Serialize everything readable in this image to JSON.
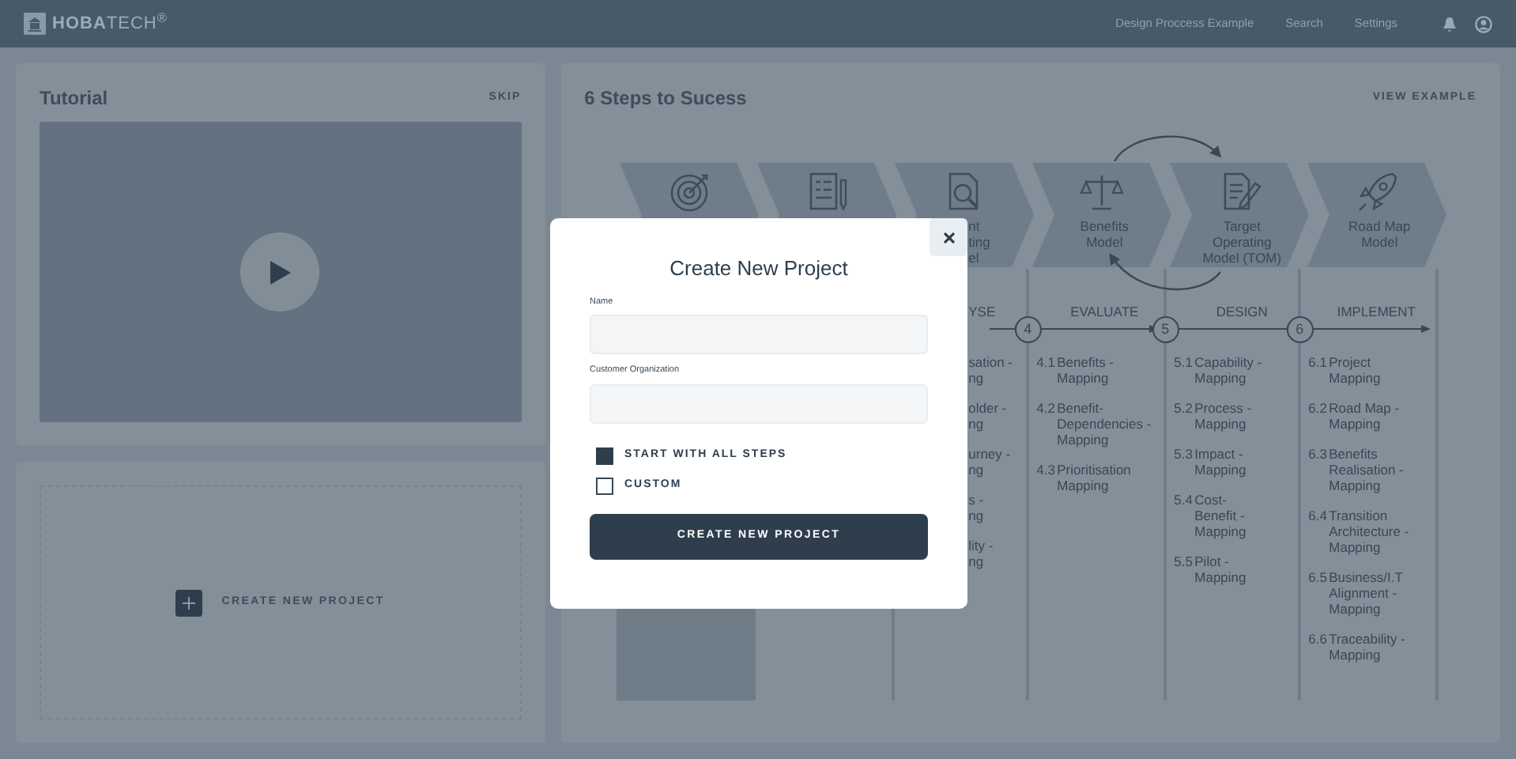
{
  "top_bar": {
    "logo": "**HOBA**TECH$^{®}$",
    "nav": [
      "Design Proccess Example",
      "Search",
      "Settings"
    ]
  },
  "tutorial": {
    "title": "Tutorial",
    "skip": "SKIP"
  },
  "new_project_card": {
    "label": "CREATE NEW PROJECT"
  },
  "steps_panel": {
    "title": "6 Steps to Sucess",
    "action": "VIEW EXAMPLE",
    "stage_labels": [
      [
        "nt",
        "ting",
        "el"
      ],
      [
        "Benefits",
        "Model"
      ],
      [
        "Target",
        "Operating",
        "Model (TOM)"
      ],
      [
        "Road Map",
        "Model"
      ]
    ],
    "phases": [
      {
        "heading": "YSE",
        "items": [
          {
            "lines": [
              "sation -",
              "ng"
            ]
          },
          {
            "lines": [
              "older -",
              "ng"
            ]
          },
          {
            "lines": [
              "urney -",
              "ng"
            ]
          },
          {
            "lines": [
              "s -",
              "ng"
            ]
          },
          {
            "lines": [
              "lity -",
              "ng"
            ]
          }
        ]
      },
      {
        "number": "4",
        "heading": "EVALUATE",
        "items": [
          {
            "number": "4.1",
            "lines": [
              "Benefits -",
              "Mapping"
            ]
          },
          {
            "number": "4.2",
            "lines": [
              "Benefit-",
              "Dependencies -",
              "Mapping"
            ]
          },
          {
            "number": "4.3",
            "lines": [
              "Prioritisation",
              "Mapping"
            ]
          }
        ]
      },
      {
        "number": "5",
        "heading": "DESIGN",
        "items": [
          {
            "number": "5.1",
            "lines": [
              "Capability -",
              "Mapping"
            ]
          },
          {
            "number": "5.2",
            "lines": [
              "Process -",
              "Mapping"
            ]
          },
          {
            "number": "5.3",
            "lines": [
              "Impact -",
              "Mapping"
            ]
          },
          {
            "number": "5.4",
            "lines": [
              "Cost-",
              "Benefit -",
              "Mapping"
            ]
          },
          {
            "number": "5.5",
            "lines": [
              "Pilot -",
              "Mapping"
            ]
          }
        ]
      },
      {
        "number": "6",
        "heading": "IMPLEMENT",
        "items": [
          {
            "number": "6.1",
            "lines": [
              "Project",
              "Mapping"
            ]
          },
          {
            "number": "6.2",
            "lines": [
              "Road Map -",
              "Mapping"
            ]
          },
          {
            "number": "6.3",
            "lines": [
              "Benefits",
              "Realisation -",
              "Mapping"
            ]
          },
          {
            "number": "6.4",
            "lines": [
              "Transition",
              "Architecture -",
              "Mapping"
            ]
          },
          {
            "number": "6.5",
            "lines": [
              "Business/I.T",
              "Alignment -",
              "Mapping"
            ]
          },
          {
            "number": "6.6",
            "lines": [
              "Traceability -",
              "Mapping"
            ]
          }
        ]
      }
    ]
  },
  "modal": {
    "title": "Create New Project",
    "fields": [
      {
        "label": "Name"
      },
      {
        "label": "Customer Organization"
      }
    ],
    "options": [
      {
        "label": "START WITH ALL STEPS",
        "checked": true
      },
      {
        "label": "CUSTOM",
        "checked": false
      }
    ],
    "submit": "CREATE NEW PROJECT"
  }
}
